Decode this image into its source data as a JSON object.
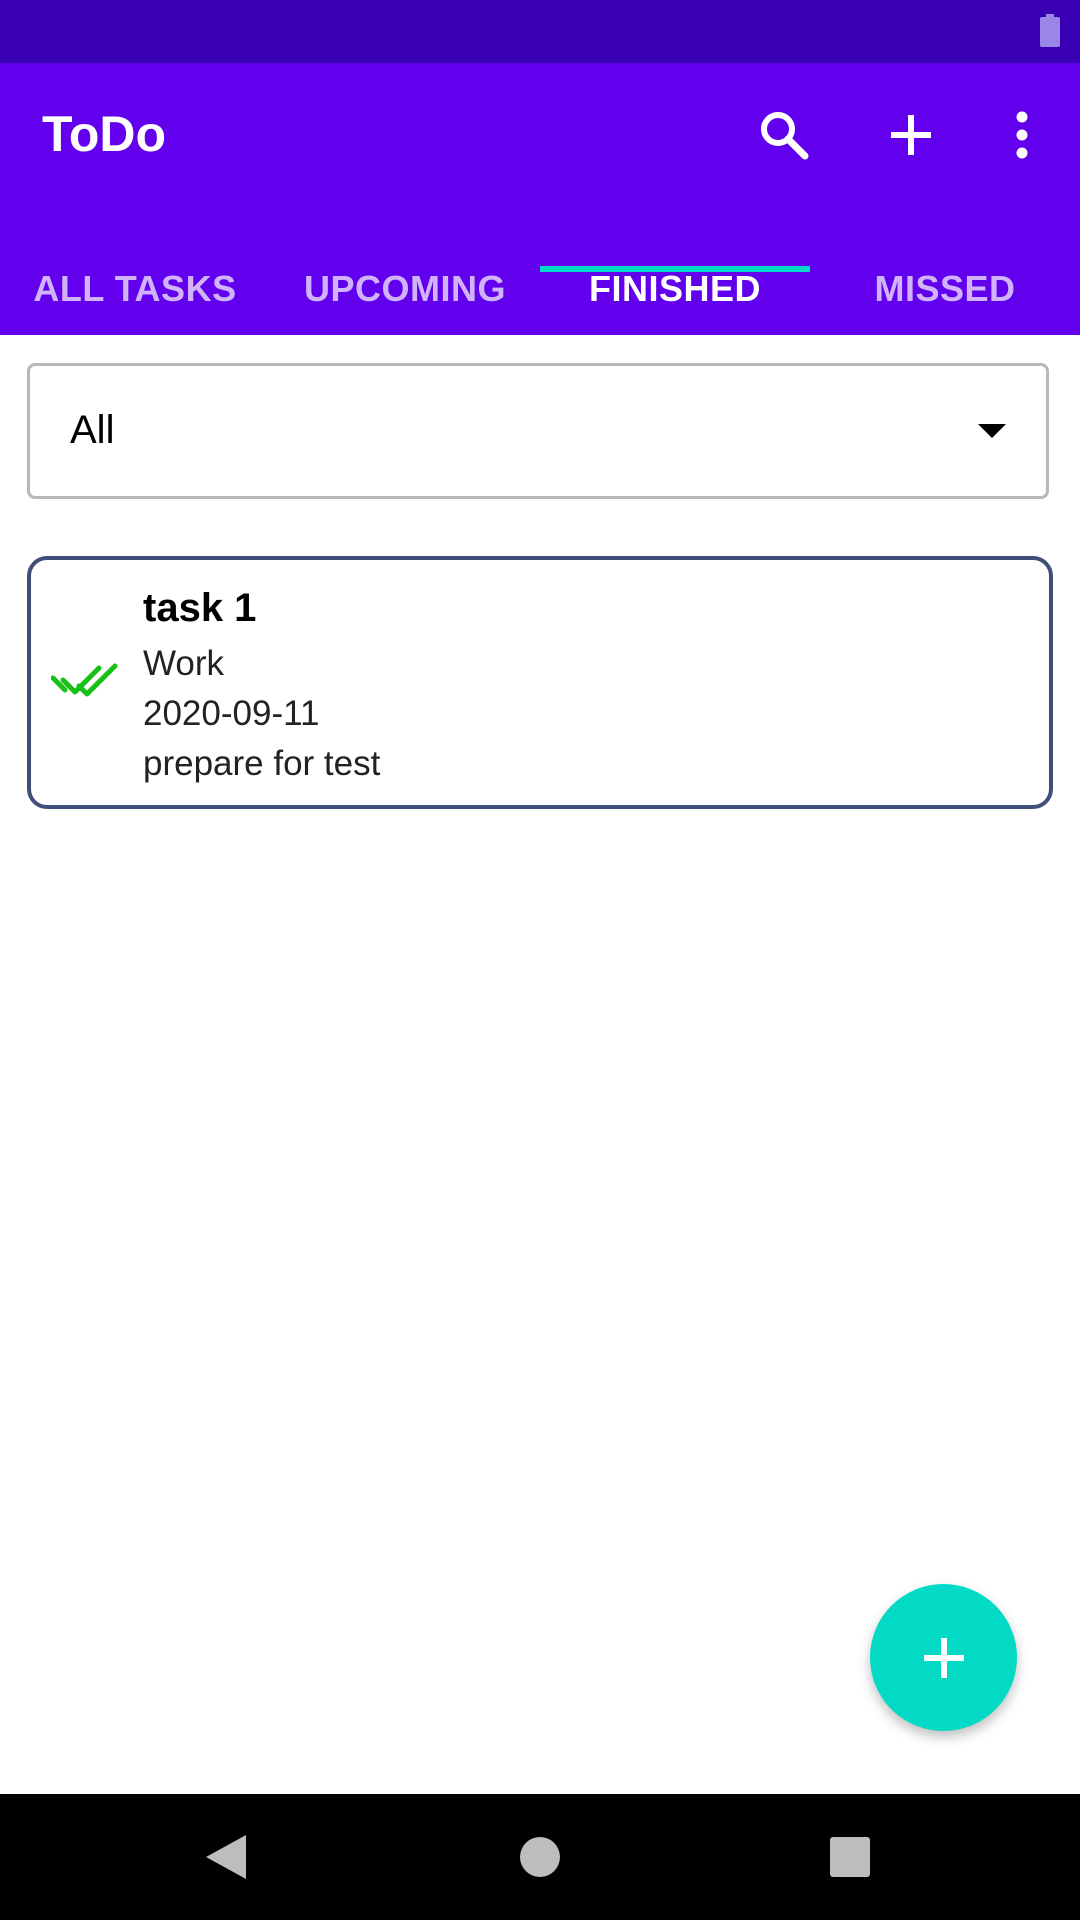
{
  "app": {
    "title": "ToDo"
  },
  "toolbar": {
    "search_icon": "search-icon",
    "add_icon": "plus-icon",
    "menu_icon": "more-vert-icon"
  },
  "tabs": [
    {
      "label": "ALL TASKS",
      "active": false
    },
    {
      "label": "UPCOMING",
      "active": false
    },
    {
      "label": "FINISHED",
      "active": true
    },
    {
      "label": "MISSED",
      "active": false
    }
  ],
  "filter": {
    "selected": "All"
  },
  "tasks": [
    {
      "title": "task 1",
      "category": "Work",
      "date": "2020-09-11",
      "description": "prepare for test",
      "status_icon": "double-check-icon"
    }
  ],
  "fab": {
    "icon": "plus-icon"
  },
  "colors": {
    "status_bar": "#3a00b3",
    "app_bar": "#6200ee",
    "accent": "#03dac5",
    "check": "#18c018",
    "card_border": "#3f4f7a"
  }
}
